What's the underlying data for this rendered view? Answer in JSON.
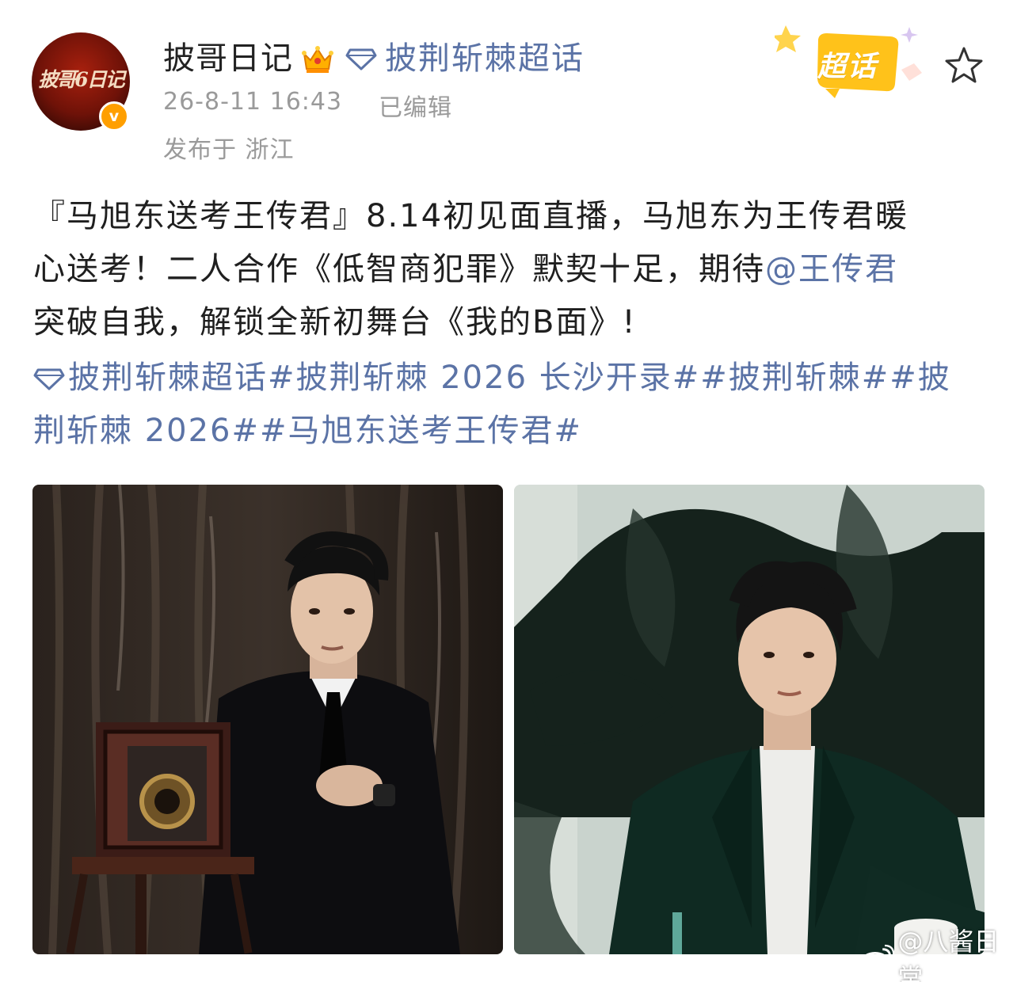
{
  "header": {
    "avatar_text": "披哥6日记",
    "username": "披哥日记",
    "super_topic": "披荆斩棘超话",
    "timestamp": "26-8-11 16:43",
    "edited": "已编辑",
    "location": "发布于 浙江",
    "supertopic_badge": "超话"
  },
  "post": {
    "line1": "『马旭东送考王传君』8.14初见面直播，马旭东为王传君暖",
    "line2_prefix": "心送考！二人合作《低智商犯罪》默契十足，期待",
    "mention": "@王传君",
    "line3": "突破自我，解锁全新初舞台《我的B面》!",
    "tags_line1": "披荆斩棘超话#披荆斩棘 2026 长沙开录##披荆斩棘##披",
    "tags_line2": "荆斩棘 2026##马旭东送考王传君#"
  },
  "watermark": {
    "text": "@八酱日常"
  },
  "icons": {
    "verified": "verified-v-icon",
    "crown": "crown-icon",
    "diamond": "diamond-icon",
    "star": "star-outline-icon",
    "weibo": "weibo-logo-icon"
  },
  "colors": {
    "link": "#5b73a6",
    "meta": "#9a9a9a",
    "verified": "#ff9f00",
    "badge": "#ffc21a"
  }
}
